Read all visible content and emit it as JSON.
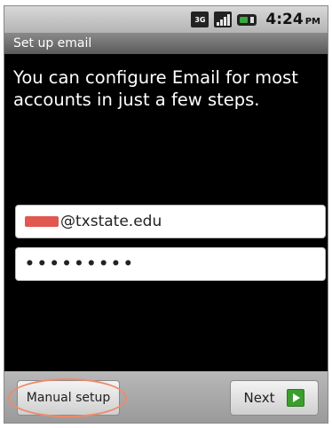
{
  "status_bar": {
    "network_icon": "3g-icon",
    "network_label_top": "3G",
    "signal_icon": "signal-strength-icon",
    "battery_icon": "battery-icon",
    "time": "4:24",
    "ampm": "PM"
  },
  "title_bar": {
    "title": "Set up email"
  },
  "intro_text": "You can configure Email for most accounts in just a few steps.",
  "form": {
    "email_value": "@txstate.edu",
    "password_value": "•••••••••"
  },
  "buttons": {
    "manual_setup_label": "Manual setup",
    "next_label": "Next",
    "next_icon": "arrow-right-icon"
  },
  "colors": {
    "highlight": "#ef8a6a",
    "next_arrow": "#3a9e2d"
  }
}
